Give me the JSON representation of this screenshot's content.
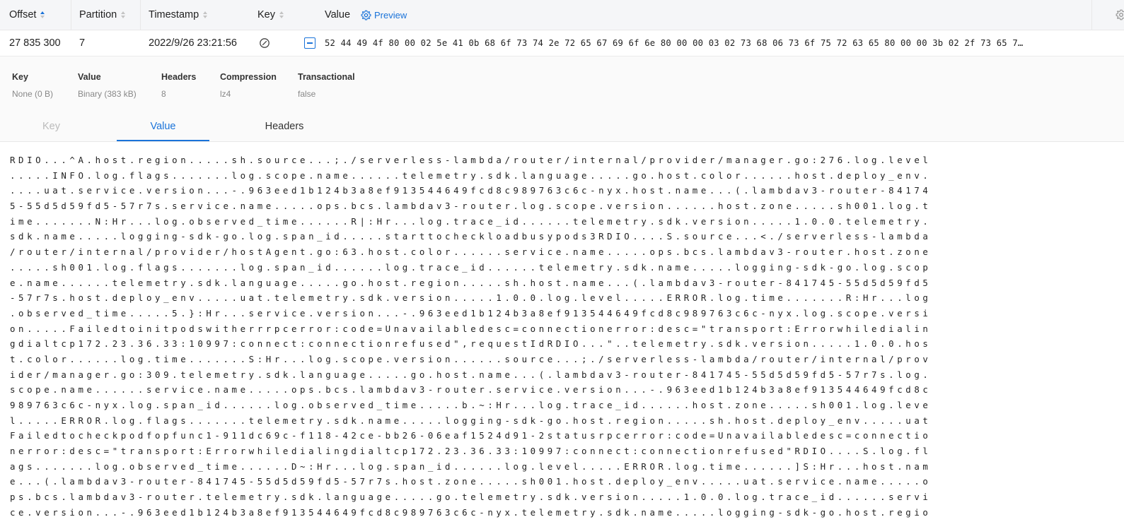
{
  "table": {
    "columns": [
      {
        "label": "Offset"
      },
      {
        "label": "Partition"
      },
      {
        "label": "Timestamp"
      },
      {
        "label": "Key"
      },
      {
        "label": "Value"
      }
    ],
    "preview_label": "Preview",
    "row": {
      "offset": "27 835 300",
      "partition": "7",
      "timestamp": "2022/9/26 23:21:56",
      "value_hex": "52 44 49 4f 80 00 02 5e 41 0b 68 6f 73 74 2e 72 65 67 69 6f 6e 80 00 00 03 02 73 68 06 73 6f 75 72 63 65 80 00 00 3b 02 2f 73 65 7…"
    }
  },
  "meta": [
    {
      "label": "Key",
      "value": "None (0 B)"
    },
    {
      "label": "Value",
      "value": "Binary (383 kB)"
    },
    {
      "label": "Headers",
      "value": "8"
    },
    {
      "label": "Compression",
      "value": "lz4"
    },
    {
      "label": "Transactional",
      "value": "false"
    }
  ],
  "tabs": [
    {
      "label": "Key",
      "state": "disabled"
    },
    {
      "label": "Value",
      "state": "active"
    },
    {
      "label": "Headers",
      "state": "normal"
    }
  ],
  "content_lines": [
    "RDIO...^A.host.region.....sh.source...;./serverless-lambda/router/internal/provider/manager.go:276.log.level",
    ".....INFO.log.flags.......log.scope.name......telemetry.sdk.language.....go.host.color......host.deploy_env.",
    "....uat.service.version...-.963eed1b124b3a8ef913544649fcd8c989763c6c-nyx.host.name...(.lambdav3-router-84174",
    "5-55d5d59fd5-57r7s.service.name.....ops.bcs.lambdav3-router.log.scope.version......host.zone.....sh001.log.t",
    "ime.......N:Hr...log.observed_time......R|:Hr...log.trace_id......telemetry.sdk.version.....1.0.0.telemetry.",
    "sdk.name.....logging-sdk-go.log.span_id.....starttocheckloadbusypods3RDIO....S.source...<./serverless-lambda",
    "/router/internal/provider/hostAgent.go:63.host.color......service.name.....ops.bcs.lambdav3-router.host.zone",
    ".....sh001.log.flags.......log.span_id......log.trace_id......telemetry.sdk.name.....logging-sdk-go.log.scop",
    "e.name......telemetry.sdk.language.....go.host.region.....sh.host.name...(.lambdav3-router-841745-55d5d59fd5",
    "-57r7s.host.deploy_env.....uat.telemetry.sdk.version.....1.0.0.log.level.....ERROR.log.time.......R:Hr...log",
    ".observed_time.....5.}:Hr...service.version...-.963eed1b124b3a8ef913544649fcd8c989763c6c-nyx.log.scope.versi",
    "on.....Failedtoinitpodswitherrrpcerror:code=Unavailabledesc=connectionerror:desc=\"transport:Errorwhiledialin",
    "gdialtcp172.23.36.33:10997:connect:connectionrefused\",requestIdRDIO...\"..telemetry.sdk.version.....1.0.0.hos",
    "t.color......log.time.......S:Hr...log.scope.version......source...;./serverless-lambda/router/internal/prov",
    "ider/manager.go:309.telemetry.sdk.language.....go.host.name...(.lambdav3-router-841745-55d5d59fd5-57r7s.log.",
    "scope.name......service.name.....ops.bcs.lambdav3-router.service.version...-.963eed1b124b3a8ef913544649fcd8c",
    "989763c6c-nyx.log.span_id......log.observed_time.....b.~:Hr...log.trace_id......host.zone.....sh001.log.leve",
    "l.....ERROR.log.flags.......telemetry.sdk.name.....logging-sdk-go.host.region.....sh.host.deploy_env.....uat",
    "Failedtocheckpodfopfunc1-911dc69c-f118-42ce-bb26-06eaf1524d91-2statusrpcerror:code=Unavailabledesc=connectio",
    "nerror:desc=\"transport:Errorwhiledialingdialtcp172.23.36.33:10997:connect:connectionrefused\"RDIO....S.log.fl",
    "ags.......log.observed_time......D~:Hr...log.span_id......log.level.....ERROR.log.time......]S:Hr...host.nam",
    "e...(.lambdav3-router-841745-55d5d59fd5-57r7s.host.zone.....sh001.host.deploy_env.....uat.service.name.....o",
    "ps.bcs.lambdav3-router.telemetry.sdk.language.....go.telemetry.sdk.version.....1.0.0.log.trace_id......servi",
    "ce.version...-.963eed1b124b3a8ef913544649fcd8c989763c6c-nyx.telemetry.sdk.name.....logging-sdk-go.host.regio"
  ],
  "colors": {
    "accent": "#1a73d9",
    "header_bg": "#f5f6f8",
    "meta_bg": "#fafafa"
  }
}
